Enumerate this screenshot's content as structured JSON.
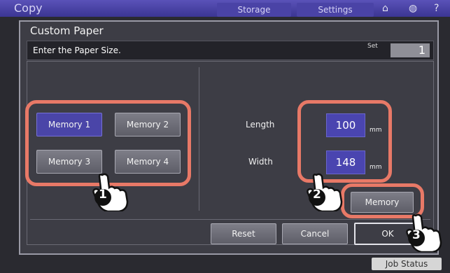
{
  "app": {
    "title": "Copy",
    "tabs": [
      "Storage",
      "Settings"
    ],
    "job_status": "Job Status"
  },
  "dialog": {
    "title": "Custom Paper",
    "message": "Enter the Paper Size.",
    "set_label": "Set",
    "set_value": "1"
  },
  "memory_buttons": [
    "Memory 1",
    "Memory 2",
    "Memory 3",
    "Memory 4"
  ],
  "selected_memory": "Memory 1",
  "size": {
    "length_label": "Length",
    "length_value": "100",
    "width_label": "Width",
    "width_value": "148",
    "unit": "mm"
  },
  "memory_button_label": "Memory",
  "footer": {
    "reset": "Reset",
    "cancel": "Cancel",
    "ok": "OK"
  },
  "callouts": [
    "1",
    "2",
    "3"
  ],
  "colors": {
    "highlight": "#e87967",
    "selected": "#4a45a8",
    "value_box": "#4a45b0"
  },
  "icons": [
    "home-icon",
    "globe-icon",
    "help-icon",
    "pointing-hand-icon"
  ]
}
